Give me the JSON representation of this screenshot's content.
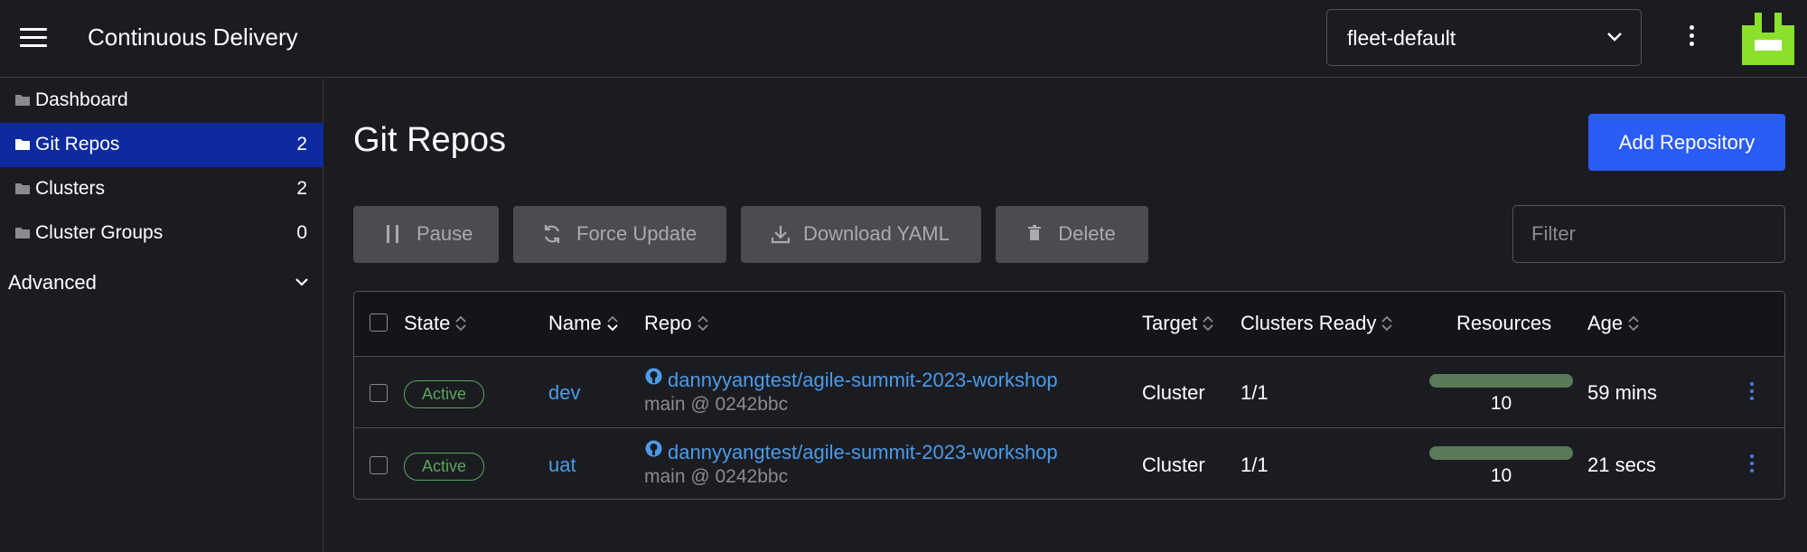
{
  "header": {
    "title": "Continuous Delivery",
    "namespace": "fleet-default"
  },
  "sidebar": {
    "items": [
      {
        "label": "Dashboard",
        "count": ""
      },
      {
        "label": "Git Repos",
        "count": "2"
      },
      {
        "label": "Clusters",
        "count": "2"
      },
      {
        "label": "Cluster Groups",
        "count": "0"
      }
    ],
    "advanced": "Advanced"
  },
  "main": {
    "title": "Git Repos",
    "add_button": "Add Repository",
    "bulk": {
      "pause": "Pause",
      "force_update": "Force Update",
      "download_yaml": "Download YAML",
      "delete": "Delete"
    },
    "filter_placeholder": "Filter"
  },
  "table": {
    "columns": {
      "state": "State",
      "name": "Name",
      "repo": "Repo",
      "target": "Target",
      "clusters_ready": "Clusters Ready",
      "resources": "Resources",
      "age": "Age"
    },
    "rows": [
      {
        "state": "Active",
        "name": "dev",
        "repo": "dannyyangtest/agile-summit-2023-workshop",
        "branch": "main @ 0242bbc",
        "target": "Cluster",
        "clusters_ready": "1/1",
        "resources": "10",
        "resources_fraction": 1.0,
        "age": "59 mins"
      },
      {
        "state": "Active",
        "name": "uat",
        "repo": "dannyyangtest/agile-summit-2023-workshop",
        "branch": "main @ 0242bbc",
        "target": "Cluster",
        "clusters_ready": "1/1",
        "resources": "10",
        "resources_fraction": 1.0,
        "age": "21 secs"
      }
    ]
  },
  "colors": {
    "accent": "#2a5cf6",
    "nav_active": "#0d2a9e",
    "active_badge": "#5aa55a",
    "link": "#4c9be8"
  }
}
